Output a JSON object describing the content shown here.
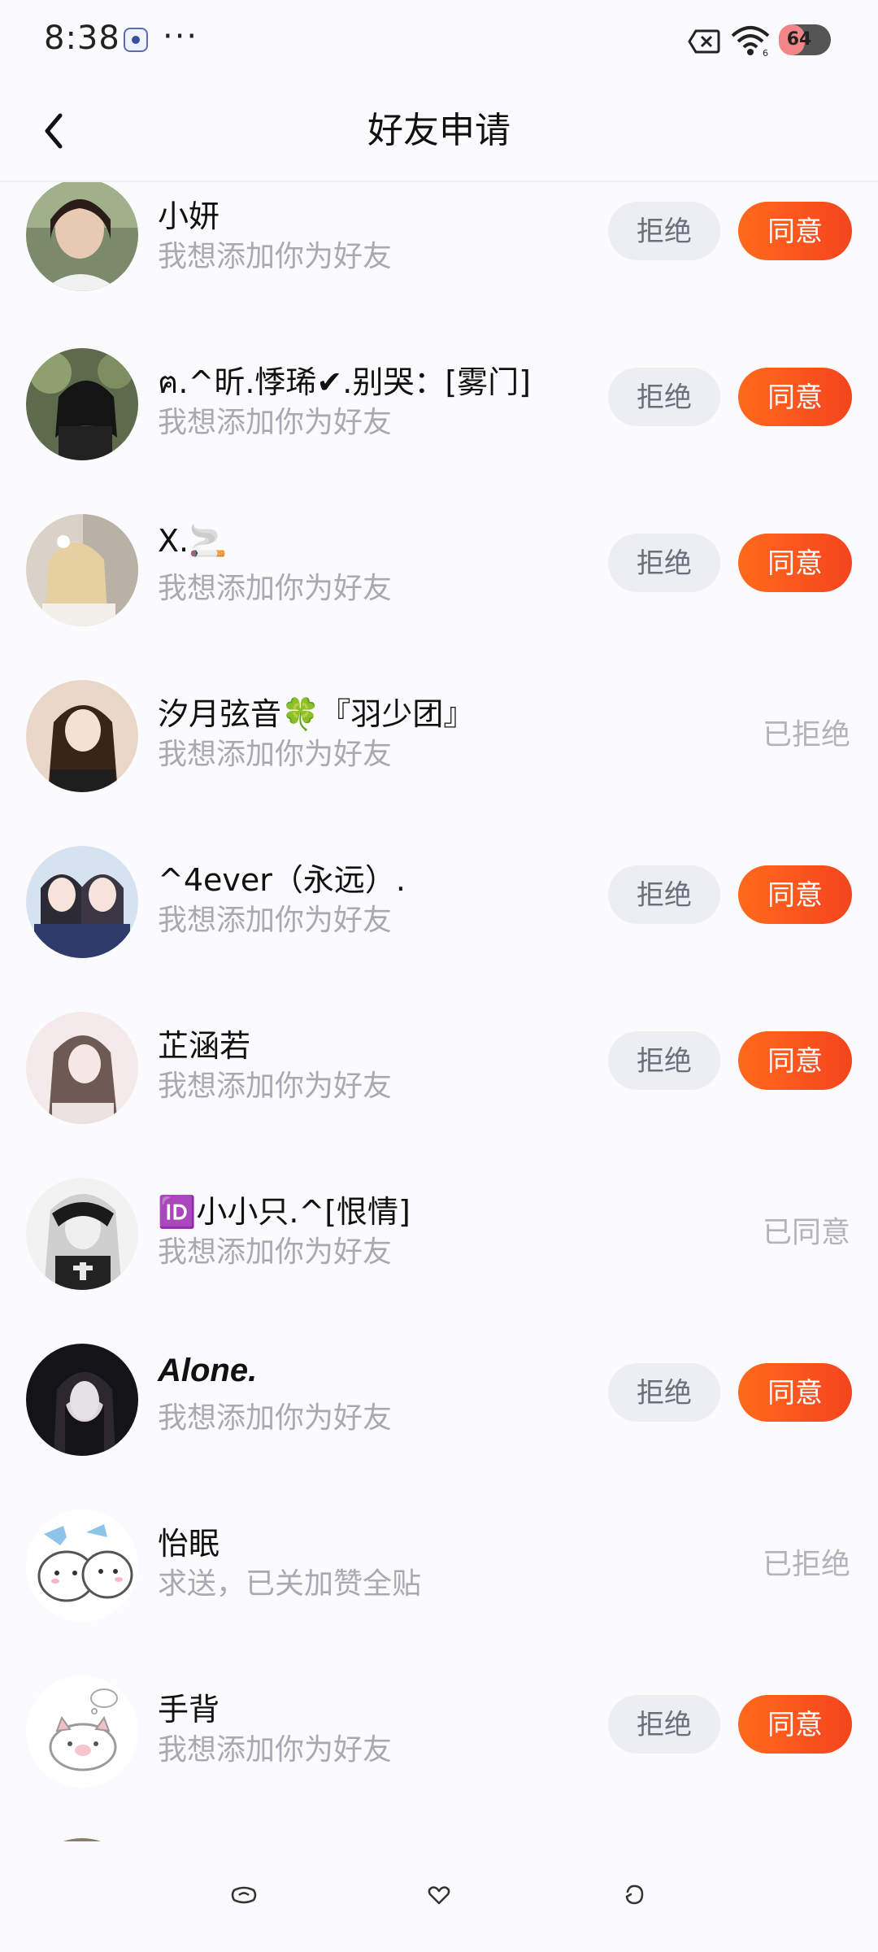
{
  "status_bar": {
    "time": "8:38",
    "dots": "···",
    "battery": 64
  },
  "header": {
    "title": "好友申请"
  },
  "actions": {
    "reject": "拒绝",
    "accept": "同意"
  },
  "requests": [
    {
      "name": "小妍",
      "message": "我想添加你为好友",
      "state": "pending"
    },
    {
      "name": "ฅ.^昕.悸琋✔.别哭：[雾门]",
      "message": "我想添加你为好友",
      "state": "pending"
    },
    {
      "name": "X.🚬",
      "message": "我想添加你为好友",
      "state": "pending"
    },
    {
      "name": "汐月弦音🍀『羽少团』",
      "message": "我想添加你为好友",
      "state": "done",
      "status": "已拒绝"
    },
    {
      "name": "^4ever（永远）.",
      "message": "我想添加你为好友",
      "state": "pending"
    },
    {
      "name": "芷涵若",
      "message": "我想添加你为好友",
      "state": "pending"
    },
    {
      "name": "🆔小小只.^[恨情]",
      "message": "我想添加你为好友",
      "state": "done",
      "status": "已同意"
    },
    {
      "name": "Alone.",
      "message": "我想添加你为好友",
      "state": "pending"
    },
    {
      "name": "怡眠",
      "message": "求送，已关加赞全贴",
      "state": "done",
      "status": "已拒绝"
    },
    {
      "name": "手背",
      "message": "我想添加你为好友",
      "state": "pending"
    }
  ],
  "colors": {
    "accent": "#f5541e",
    "reject_bg": "#eceef4",
    "muted_text": "#a9a9b3"
  }
}
